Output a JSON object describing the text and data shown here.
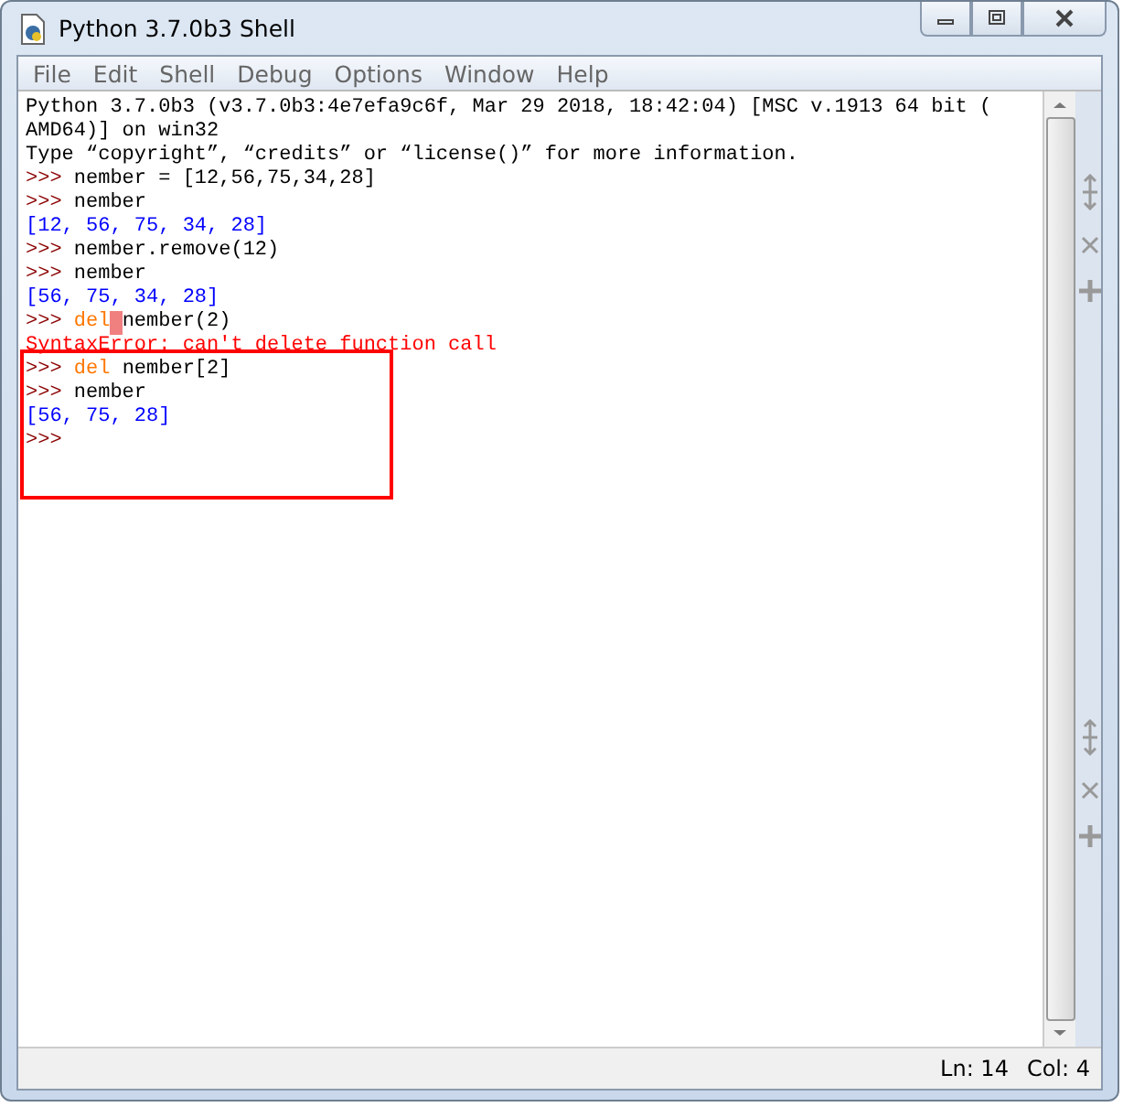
{
  "window": {
    "title": "Python 3.7.0b3 Shell"
  },
  "menu": [
    "File",
    "Edit",
    "Shell",
    "Debug",
    "Options",
    "Window",
    "Help"
  ],
  "shell_lines": [
    {
      "kind": "banner",
      "text": "Python 3.7.0b3 (v3.7.0b3:4e7efa9c6f, Mar 29 2018, 18:42:04) [MSC v.1913 64 bit ("
    },
    {
      "kind": "banner",
      "text": "AMD64)] on win32"
    },
    {
      "kind": "banner",
      "text": "Type “copyright”, “credits” or “license()” for more information."
    },
    {
      "kind": "input",
      "prompt": ">>>",
      "code": "nember = [12,56,75,34,28]"
    },
    {
      "kind": "input",
      "prompt": ">>>",
      "code": "nember"
    },
    {
      "kind": "output",
      "text": "[12, 56, 75, 34, 28]"
    },
    {
      "kind": "input",
      "prompt": ">>>",
      "code": "nember.remove(12)"
    },
    {
      "kind": "input",
      "prompt": ">>>",
      "code": "nember"
    },
    {
      "kind": "output",
      "text": "[56, 75, 34, 28]"
    },
    {
      "kind": "input",
      "prompt": ">>>",
      "keyword": "del",
      "code": "nember(2)",
      "marked": true
    },
    {
      "kind": "error",
      "text": "SyntaxError: can't delete function call"
    },
    {
      "kind": "input",
      "prompt": ">>>",
      "keyword": "del",
      "code": "nember[2]",
      "marked": false
    },
    {
      "kind": "input",
      "prompt": ">>>",
      "code": "nember"
    },
    {
      "kind": "output",
      "text": "[56, 75, 28]"
    },
    {
      "kind": "input",
      "prompt": ">>>"
    }
  ],
  "status_bar": {
    "line": "Ln: 14",
    "column": "Col: 4"
  }
}
